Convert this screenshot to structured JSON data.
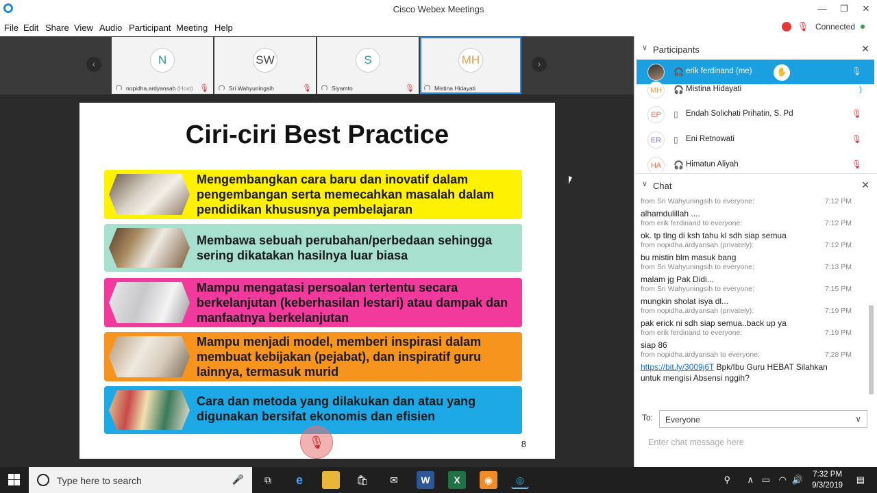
{
  "window": {
    "title": "Cisco Webex Meetings",
    "minimize": "—",
    "restore": "❐",
    "close": "✕"
  },
  "menu": [
    "File",
    "Edit",
    "Share",
    "View",
    "Audio",
    "Participant",
    "Meeting",
    "Help"
  ],
  "status": {
    "text": "Connected",
    "record_icon": "record-icon",
    "mic_icon": "mic-muted-icon"
  },
  "video_strip": {
    "prev": "‹",
    "next": "›",
    "tiles": [
      {
        "initials": "N",
        "name": "nopidha.ardyansah",
        "tag": "(Host)",
        "color": "#2a9a8f"
      },
      {
        "initials": "SW",
        "name": "Sri Wahyuningsih",
        "tag": "",
        "color": "#444444"
      },
      {
        "initials": "S",
        "name": "Siyamto",
        "tag": "",
        "color": "#2a9a8f"
      },
      {
        "initials": "MH",
        "name": "Mistina Hidayati",
        "tag": "",
        "color": "#e0a040"
      }
    ]
  },
  "slide": {
    "title": "Ciri-ciri Best Practice",
    "page": "8",
    "items": [
      {
        "text": "Mengembangkan cara baru dan inovatif dalam pengembangan serta memecahkan masalah dalam pendidikan khususnya pembelajaran",
        "color": "#fff200"
      },
      {
        "text": "Membawa sebuah perubahan/perbedaan sehingga sering dikatakan hasilnya luar biasa",
        "color": "#a8e0cf"
      },
      {
        "text": "Mampu mengatasi persoalan tertentu secara berkelanjutan (keberhasilan lestari) atau dampak dan manfaatnya berkelanjutan",
        "color": "#f13a9b"
      },
      {
        "text": "Mampu menjadi model, memberi inspirasi dalam membuat kebijakan (pejabat), dan inspiratif guru lainnya, termasuk murid",
        "color": "#f7941d"
      },
      {
        "text": "Cara dan metoda yang dilakukan dan atau yang digunakan bersifat ekonomis dan efisien",
        "color": "#1ca9e6"
      }
    ]
  },
  "participants": {
    "label": "Participants",
    "list": [
      {
        "initials": "",
        "name": "erik ferdinand  (me)",
        "me": true,
        "color": "#555"
      },
      {
        "initials": "MH",
        "name": "Mistina Hidayati",
        "me": false,
        "color": "#e0a040"
      },
      {
        "initials": "EP",
        "name": "Endah Solichati Prihatin, S. Pd",
        "me": false,
        "color": "#e57050"
      },
      {
        "initials": "ER",
        "name": "Eni Retnowati",
        "me": false,
        "color": "#8a6fb8"
      },
      {
        "initials": "HA",
        "name": "Himatun Aliyah",
        "me": false,
        "color": "#e57050"
      }
    ]
  },
  "chat": {
    "label": "Chat",
    "messages": [
      {
        "from": "from Sri Wahyuningsih to everyone:",
        "time": "7:12 PM",
        "body": "alhamdulillah ...."
      },
      {
        "from": "from erik ferdinand to everyone:",
        "time": "7:12 PM",
        "body": "ok. tp tlng di ksh tahu kl sdh siap semua"
      },
      {
        "from": "from nopidha.ardyansah (privately):",
        "time": "7:12 PM",
        "body": "bu mistin blm masuk bang"
      },
      {
        "from": "from Sri Wahyuningsih to everyone:",
        "time": "7:13 PM",
        "body": "malam jg Pak Didi..."
      },
      {
        "from": "from Sri Wahyuningsih to everyone:",
        "time": "7:15 PM",
        "body": "mungkin sholat isya dl..."
      },
      {
        "from": "from nopidha.ardyansah (privately):",
        "time": "7:19 PM",
        "body": "pak erick ni sdh siap semua..back up ya"
      },
      {
        "from": "from erik ferdinand to everyone:",
        "time": "7:19 PM",
        "body": "siap 86"
      },
      {
        "from": "from nopidha.ardyansah to everyone:",
        "time": "7:28 PM",
        "link": "https://bit.ly/3009j6T",
        "body": " Bpk/Ibu Guru HEBAT Silahkan untuk mengisi Absensi nggih?"
      }
    ],
    "to_label": "To:",
    "to_value": "Everyone",
    "placeholder": "Enter chat message here"
  },
  "taskbar": {
    "search_placeholder": "Type here to search",
    "time": "7:32 PM",
    "date": "9/3/2019"
  }
}
